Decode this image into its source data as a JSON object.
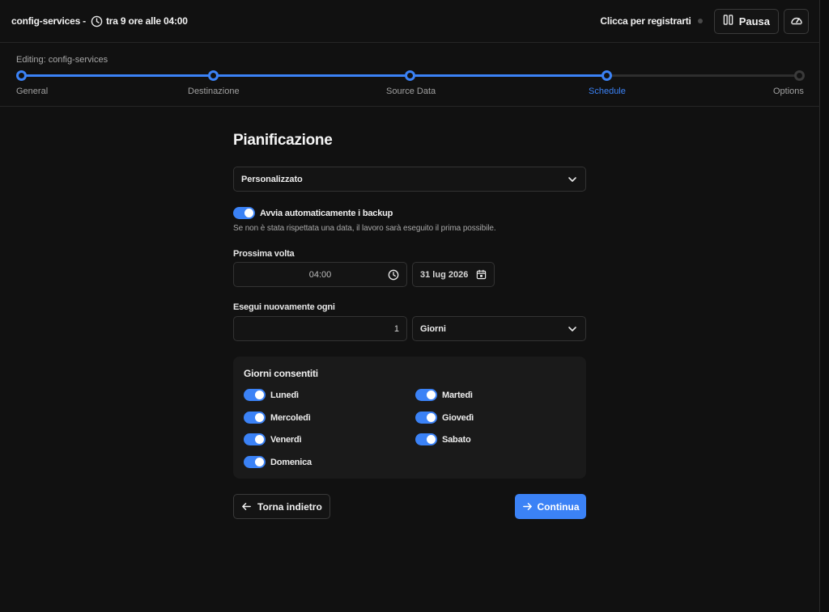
{
  "header": {
    "job_name": "config-services -",
    "next_run": "tra 9 ore alle 04:00",
    "register_text": "Clicca per registrarti",
    "pause_label": "Pausa"
  },
  "stepper": {
    "editing_label": "Editing: config-services",
    "steps": [
      {
        "label": "General",
        "state": "done"
      },
      {
        "label": "Destinazione",
        "state": "done"
      },
      {
        "label": "Source Data",
        "state": "done"
      },
      {
        "label": "Schedule",
        "state": "active"
      },
      {
        "label": "Options",
        "state": "pending"
      }
    ],
    "progress_fraction": 0.75
  },
  "form": {
    "title": "Pianificazione",
    "schedule_type": "Personalizzato",
    "auto_start_label": "Avvia automaticamente i backup",
    "auto_start_enabled": true,
    "auto_start_hint": "Se non è stata rispettata una data, il lavoro sarà eseguito il prima possibile.",
    "next_time_label": "Prossima volta",
    "next_time_value": "04:00",
    "next_date_value": "31 lug 2026",
    "repeat_label": "Esegui nuovamente ogni",
    "repeat_value": "1",
    "repeat_unit": "Giorni",
    "allowed_days_title": "Giorni consentiti",
    "days": [
      {
        "label": "Lunedì",
        "enabled": true
      },
      {
        "label": "Martedì",
        "enabled": true
      },
      {
        "label": "Mercoledì",
        "enabled": true
      },
      {
        "label": "Giovedì",
        "enabled": true
      },
      {
        "label": "Venerdì",
        "enabled": true
      },
      {
        "label": "Sabato",
        "enabled": true
      },
      {
        "label": "Domenica",
        "enabled": true
      }
    ],
    "back_label": "Torna indietro",
    "continue_label": "Continua"
  },
  "colors": {
    "accent": "#3b82f6",
    "background": "#111111",
    "card": "#1a1a1a"
  }
}
